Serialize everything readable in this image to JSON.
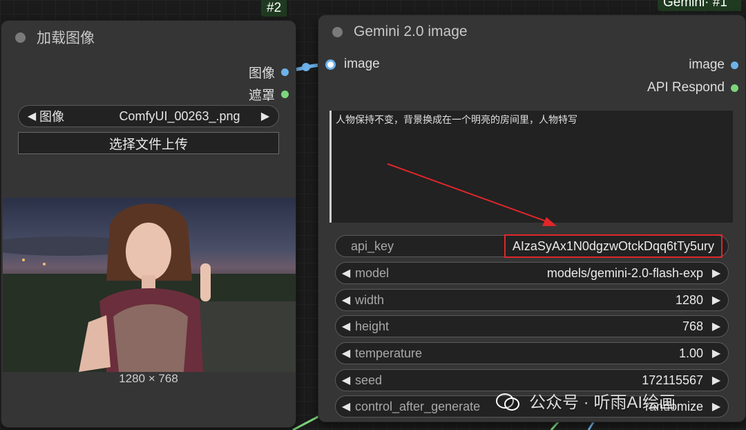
{
  "nodes": {
    "load": {
      "id": "#2",
      "title": "加载图像",
      "outputs": [
        {
          "label": "图像",
          "color": "#6db2ea"
        },
        {
          "label": "遮罩",
          "color": "#7cd47c"
        }
      ],
      "combo": {
        "label": "图像",
        "value": "ComfyUI_00263_.png"
      },
      "upload_label": "选择文件上传",
      "preview_size": "1280 × 768"
    },
    "gemini": {
      "id": "Gemini· #1",
      "title": "Gemini 2.0 image",
      "input": {
        "label": "image",
        "color": "#6db2ea"
      },
      "outputs": [
        {
          "label": "image",
          "color": "#6db2ea"
        },
        {
          "label": "API Respond",
          "color": "#7cd47c"
        }
      ],
      "prompt": "人物保持不变，背景换成在一个明亮的房间里，人物特写",
      "api_key": {
        "label": "api_key",
        "value": "AIzaSyAx1N0dgzwOtckDqq6tTy5ury"
      },
      "widgets": [
        {
          "label": "model",
          "value": "models/gemini-2.0-flash-exp"
        },
        {
          "label": "width",
          "value": "1280"
        },
        {
          "label": "height",
          "value": "768"
        },
        {
          "label": "temperature",
          "value": "1.00"
        },
        {
          "label": "seed",
          "value": "172115567"
        },
        {
          "label": "control_after_generate",
          "value": "randomize"
        }
      ]
    }
  },
  "watermark": "公众号 · 听雨AI绘画",
  "colors": {
    "highlight": "#e0262a",
    "image_wire": "#6db2ea",
    "mask_wire": "#7cd47c"
  }
}
